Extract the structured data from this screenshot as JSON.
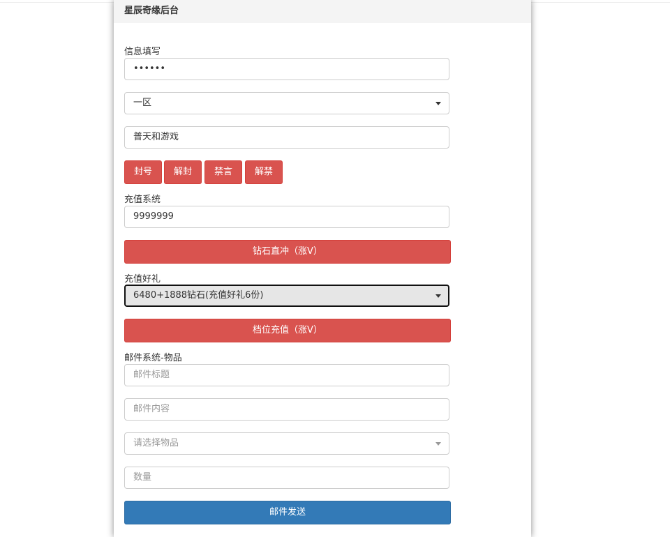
{
  "header": {
    "title": "星辰奇缘后台"
  },
  "info": {
    "label": "信息填写",
    "account_value": "••••••",
    "region_value": "一区",
    "name_value": "普天和游戏"
  },
  "actions": {
    "ban": "封号",
    "unban": "解封",
    "mute": "禁言",
    "unmute": "解禁"
  },
  "recharge": {
    "label": "充值系统",
    "amount_value": "9999999",
    "diamond_button": "钻石直冲（涨V）"
  },
  "gift": {
    "label": "充值好礼",
    "selected": "6480+1888钻石(充值好礼6份)",
    "tier_button": "档位充值（涨V）"
  },
  "mail": {
    "label": "邮件系统-物品",
    "title_placeholder": "邮件标题",
    "content_placeholder": "邮件内容",
    "item_placeholder": "请选择物品",
    "quantity_placeholder": "数量",
    "send_button": "邮件发送"
  }
}
